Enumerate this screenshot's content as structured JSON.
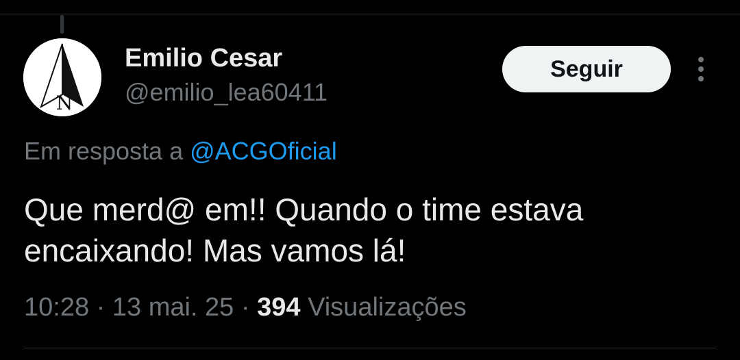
{
  "tweet": {
    "author": {
      "display_name": "Emilio Cesar",
      "handle": "@emilio_lea60411",
      "avatar_icon": "north-arrow-icon",
      "avatar_letter": "N"
    },
    "follow_label": "Seguir",
    "more_icon": "more-options-icon",
    "reply_prefix": "Em resposta a",
    "reply_to": "@ACGOficial",
    "text": "Que merd@ em!! Quando o time estava encaixando! Mas vamos lá!",
    "time": "10:28",
    "date": "13 mai. 25",
    "views_count": "394",
    "views_label": "Visualizações"
  },
  "colors": {
    "background": "#000000",
    "primary_text": "#e7e9ea",
    "secondary_text": "#71767b",
    "link": "#1d9bf0",
    "button_bg": "#eff3f4",
    "divider": "#2f3336"
  }
}
